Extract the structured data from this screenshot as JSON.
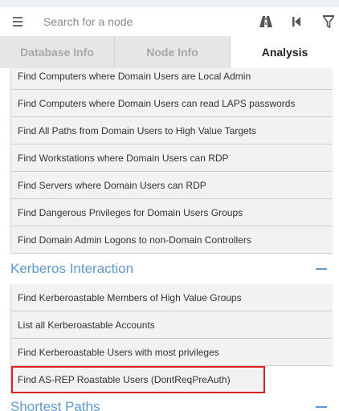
{
  "search": {
    "placeholder": "Search for a node"
  },
  "icons": {
    "menu": "hamburger-menu-icon",
    "pathfinding": "road-path-icon",
    "back": "skip-back-icon",
    "filter": "filter-icon"
  },
  "tabs": [
    {
      "label": "Database Info",
      "active": false
    },
    {
      "label": "Node Info",
      "active": false
    },
    {
      "label": "Analysis",
      "active": true
    }
  ],
  "sections": {
    "domain_users_queries": [
      "Find Computers where Domain Users are Local Admin",
      "Find Computers where Domain Users can read LAPS passwords",
      "Find All Paths from Domain Users to High Value Targets",
      "Find Workstations where Domain Users can RDP",
      "Find Servers where Domain Users can RDP",
      "Find Dangerous Privileges for Domain Users Groups",
      "Find Domain Admin Logons to non-Domain Controllers"
    ],
    "kerberos": {
      "title": "Kerberos Interaction",
      "queries": [
        "Find Kerberoastable Members of High Value Groups",
        "List all Kerberoastable Accounts",
        "Find Kerberoastable Users with most privileges",
        "Find AS-REP Roastable Users (DontReqPreAuth)"
      ]
    },
    "shortest_paths": {
      "title": "Shortest Paths"
    }
  },
  "colors": {
    "accent": "#5b9bd5",
    "highlight_box": "#e02020"
  }
}
